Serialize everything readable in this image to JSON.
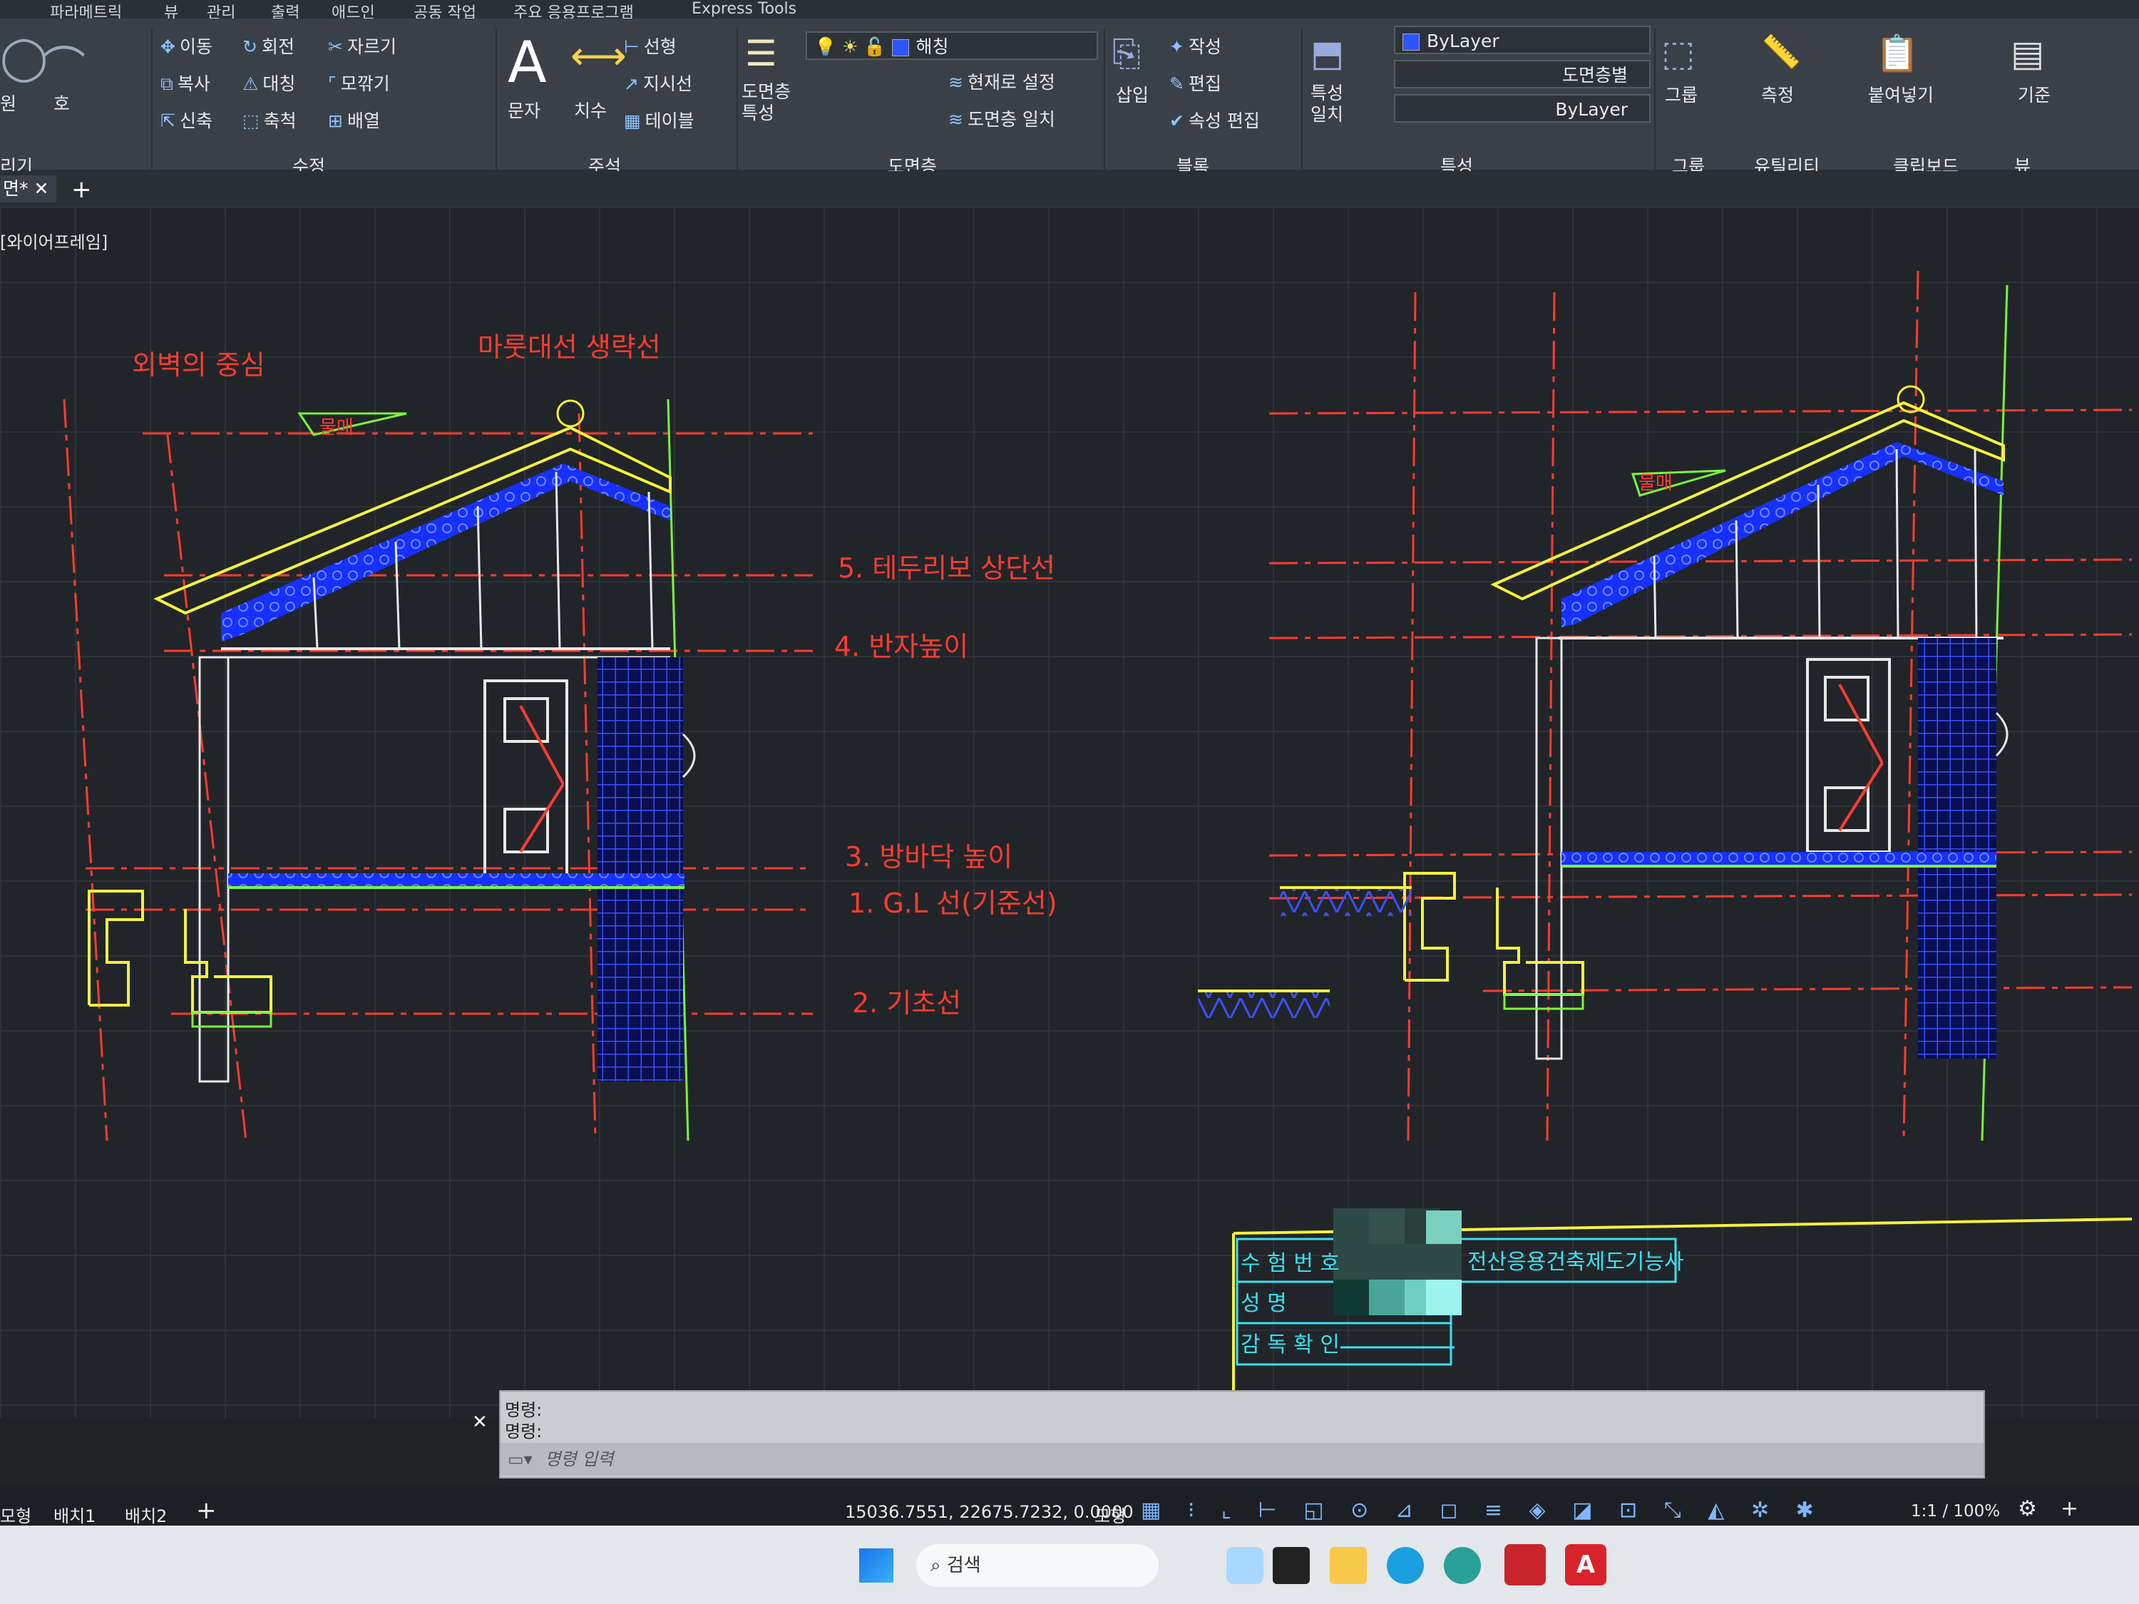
{
  "menu": {
    "items": [
      "파라메트릭",
      "뷰",
      "관리",
      "출력",
      "애드인",
      "공동 작업",
      "주요 응용프로그램",
      "Express Tools"
    ]
  },
  "ribbon": {
    "modify": {
      "move": "이동",
      "rotate": "회전",
      "trim": "자르기",
      "copy": "복사",
      "mirror": "대칭",
      "fillet": "모깎기",
      "stretch": "신축",
      "scale": "축척",
      "array": "배열",
      "group_label": "수정"
    },
    "annotation": {
      "text": "문자",
      "dimension": "치수",
      "linear": "선형",
      "leader": "지시선",
      "table": "테이블",
      "group_label": "주석"
    },
    "layers": {
      "properties": "도면층 특성",
      "current_layer": "해칭",
      "set_current": "현재로 설정",
      "match": "도면층 일치",
      "group_label": "도면층"
    },
    "block": {
      "insert": "삽입",
      "create": "작성",
      "edit": "편집",
      "edit_attr": "속성 편집",
      "group_label": "블록"
    },
    "properties": {
      "match_props": "특성 일치",
      "color": "ByLayer",
      "linetype": "도면층별",
      "lineweight": "ByLayer",
      "group_label": "특성"
    },
    "groups": {
      "group": "그룹",
      "group_label": "그룹"
    },
    "utilities": {
      "measure": "측정",
      "group_label": "유틸리티"
    },
    "clipboard": {
      "paste": "붙여넣기",
      "group_label": "클립보드"
    },
    "view": {
      "base": "기준",
      "group_label": "뷰"
    },
    "left_fragments": {
      "circle": "원",
      "arc": "호",
      "draw_group": "리기"
    }
  },
  "doc_tabs": {
    "tab": "면*",
    "add": "+"
  },
  "viewport_label": "[와이어프레임]",
  "drawing": {
    "annotations": {
      "outer_wall": "외벽의 중심",
      "ridge": "마룻대선  생략선",
      "line5": "5. 테두리보 상단선",
      "line4": "4. 반자높이",
      "line3": "3. 방바닥 높이",
      "line1": "1. G.L 선(기준선)",
      "line2": "2. 기초선",
      "slope1": "물매",
      "slope2": "물매"
    },
    "title_block": {
      "exam_no": "수 험 번 호",
      "name": "성    명",
      "supervisor": "감 독 확 인",
      "qualification": "전산응용건축제도기능사"
    },
    "colors": {
      "red": "#ff3b30",
      "yellow": "#f4f23a",
      "green": "#7bf53a",
      "blue": "#2a3bff",
      "white": "#e8e8e8",
      "cyan": "#3ae0f0"
    }
  },
  "command": {
    "line1": "명령:",
    "line2": "명령:",
    "input_placeholder": "명령 입력"
  },
  "status": {
    "coords": "15036.7551, 22675.7232, 0.0000",
    "model": "모형",
    "scale": "1:1 / 100%"
  },
  "layout_tabs": [
    "모형",
    "배치1",
    "배치2"
  ],
  "taskbar": {
    "search": "검색"
  }
}
